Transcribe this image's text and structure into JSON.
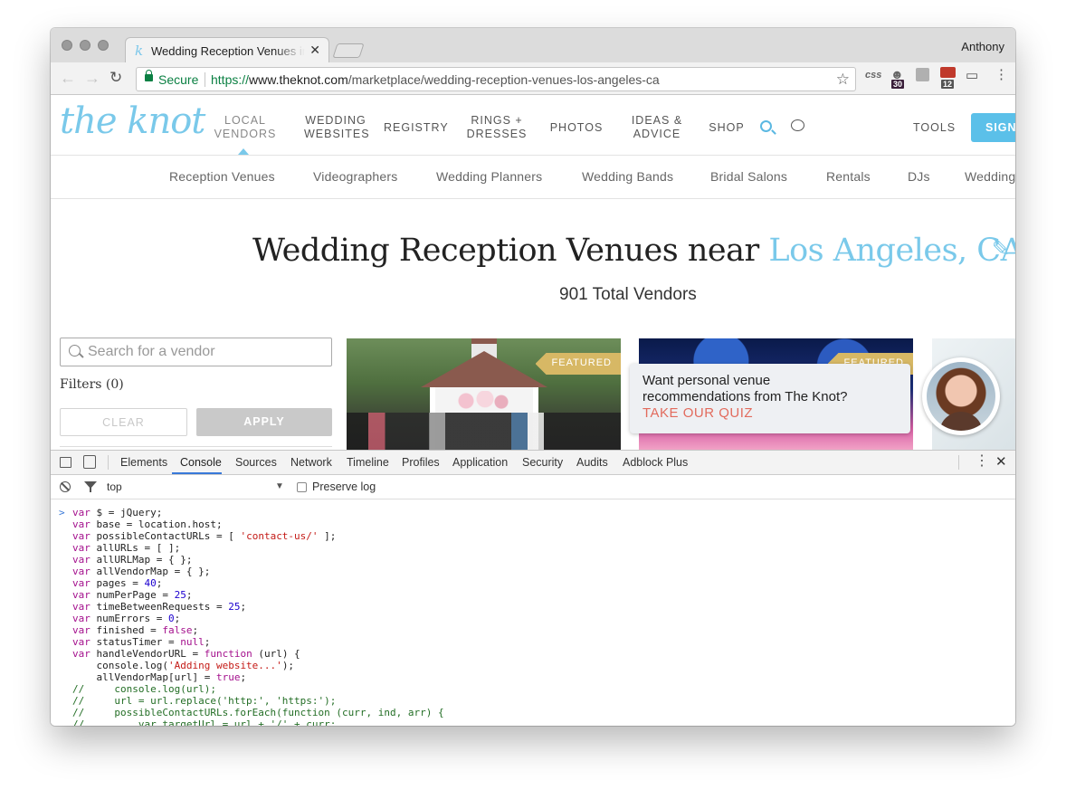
{
  "browser": {
    "tab_title": "Wedding Reception Venues in Los Angeles, CA",
    "tab_close": "✕",
    "profile_name": "Anthony",
    "secure_label": "Secure",
    "url_scheme": "https://",
    "url_host": "www.theknot.com",
    "url_path": "/marketplace/wedding-reception-venues-los-angeles-ca",
    "extensions": {
      "css_label": "css",
      "badge_one": "30",
      "badge_two": "12"
    },
    "icons": [
      "back-icon",
      "forward-icon",
      "reload-icon",
      "lock-icon",
      "star-icon",
      "cast-icon",
      "menu-icon"
    ]
  },
  "site": {
    "logo": "the knot",
    "main_nav": [
      {
        "line1": "LOCAL",
        "line2": "VENDORS"
      },
      {
        "line1": "WEDDING",
        "line2": "WEBSITES"
      },
      {
        "line1": "REGISTRY",
        "line2": ""
      },
      {
        "line1": "RINGS +",
        "line2": "DRESSES"
      },
      {
        "line1": "PHOTOS",
        "line2": ""
      },
      {
        "line1": "IDEAS &",
        "line2": "ADVICE"
      },
      {
        "line1": "SHOP",
        "line2": ""
      }
    ],
    "tools_label": "TOOLS",
    "sign_label": "SIGN",
    "subnav": [
      "Reception Venues",
      "Videographers",
      "Wedding Planners",
      "Wedding Bands",
      "Bridal Salons",
      "Rentals",
      "DJs",
      "Wedding"
    ],
    "title_prefix": "Wedding Reception Venues near ",
    "title_location": "Los Angeles, CA",
    "vendor_count": "901 Total Vendors",
    "search_placeholder": "Search for a vendor",
    "filters_label": "Filters (0)",
    "clear_label": "CLEAR",
    "apply_label": "APPLY",
    "featured_label": "FEATURED",
    "quiz": {
      "text": "Want personal venue recommendations from The Knot?",
      "link": "TAKE OUR QUIZ"
    },
    "accent_color": "#7ac9ea",
    "featured_color": "#d7b865",
    "quiz_link_color": "#e26b5d"
  },
  "devtools": {
    "tabs": [
      "Elements",
      "Console",
      "Sources",
      "Network",
      "Timeline",
      "Profiles",
      "Application",
      "Security",
      "Audits",
      "Adblock Plus"
    ],
    "active_tab": "Console",
    "context": "top",
    "preserve_log_label": "Preserve log",
    "prompt": ">",
    "code_lines": [
      "var $ = jQuery;",
      "var base = location.host;",
      "var possibleContactURLs = [ 'contact-us/' ];",
      "var allURLs = [ ];",
      "var allURLMap = { };",
      "var allVendorMap = { };",
      "var pages = 40;",
      "var numPerPage = 25;",
      "var timeBetweenRequests = 25;",
      "var numErrors = 0;",
      "var finished = false;",
      "var statusTimer = null;",
      "var handleVendorURL = function (url) {",
      "    console.log('Adding website...');",
      "    allVendorMap[url] = true;",
      "//     console.log(url);",
      "//     url = url.replace('http:', 'https:');",
      "//     possibleContactURLs.forEach(function (curr, ind, arr) {",
      "//         var targetUrl = url + '/' + curr;"
    ]
  }
}
